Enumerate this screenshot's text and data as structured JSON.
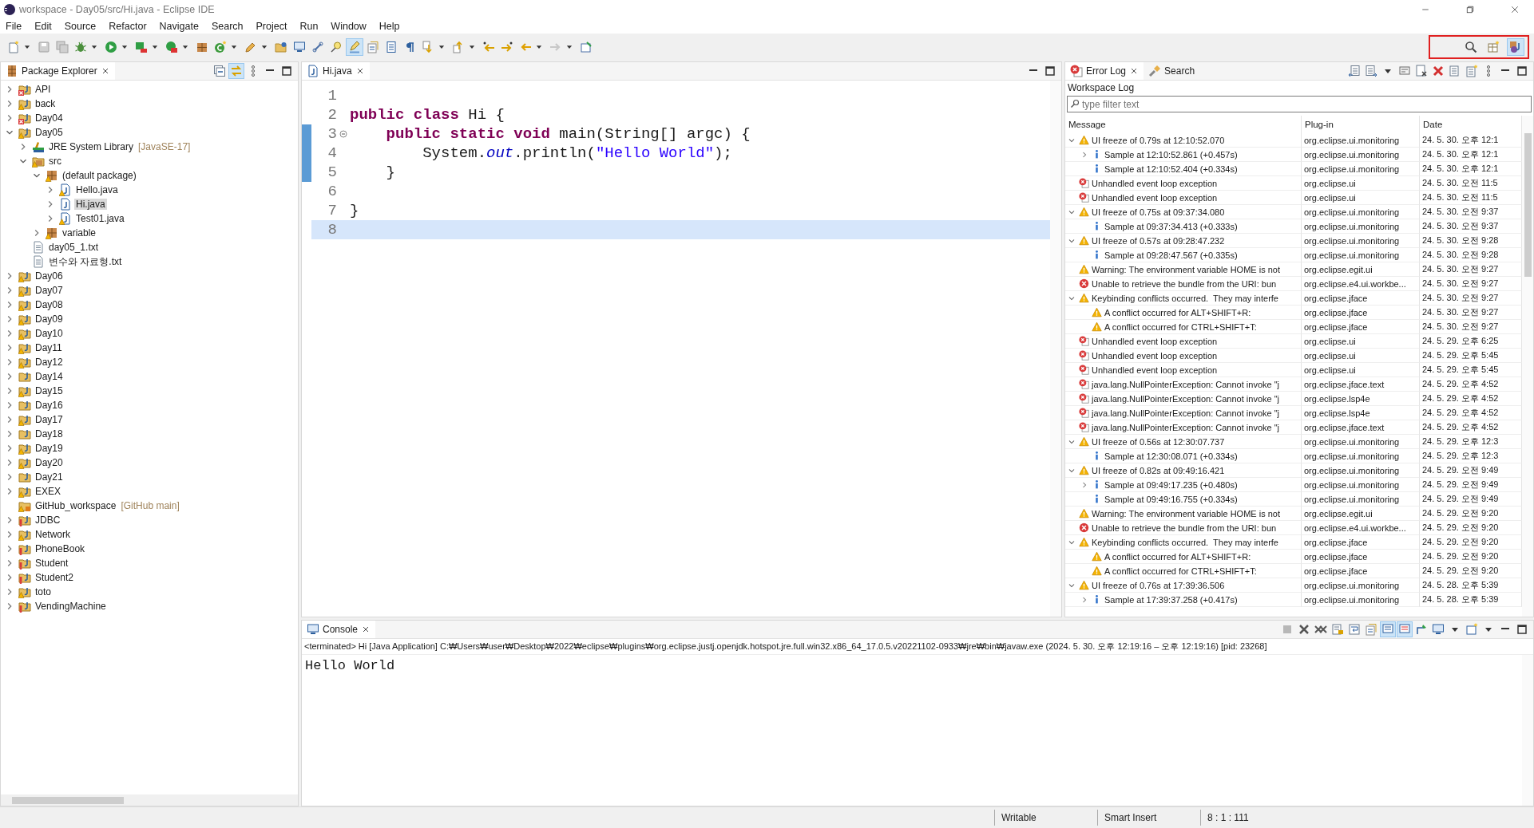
{
  "window": {
    "title": "workspace - Day05/src/Hi.java - Eclipse IDE"
  },
  "menu": [
    "File",
    "Edit",
    "Source",
    "Refactor",
    "Navigate",
    "Search",
    "Project",
    "Run",
    "Window",
    "Help"
  ],
  "toolbar": [
    {
      "kind": "new",
      "dropdown": true,
      "pressed": false
    },
    {
      "kind": "save",
      "dropdown": false,
      "pressed": false
    },
    {
      "kind": "saveall",
      "dropdown": false,
      "pressed": false
    },
    {
      "kind": "bug",
      "dropdown": true,
      "pressed": false
    },
    {
      "kind": "run",
      "dropdown": true,
      "pressed": false
    },
    {
      "kind": "coverage",
      "dropdown": true,
      "pressed": false
    },
    {
      "kind": "external",
      "dropdown": true,
      "pressed": false
    },
    {
      "kind": "package",
      "dropdown": false,
      "pressed": false
    },
    {
      "kind": "classnew",
      "dropdown": true,
      "pressed": false
    },
    {
      "kind": "pencil",
      "dropdown": true,
      "pressed": false
    },
    {
      "kind": "folder",
      "dropdown": false,
      "pressed": false
    },
    {
      "kind": "monitor",
      "dropdown": false,
      "pressed": false
    },
    {
      "kind": "link",
      "dropdown": false,
      "pressed": false
    },
    {
      "kind": "bulb",
      "dropdown": false,
      "pressed": false
    },
    {
      "kind": "highlight",
      "dropdown": false,
      "pressed": true
    },
    {
      "kind": "docref",
      "dropdown": false,
      "pressed": false
    },
    {
      "kind": "block",
      "dropdown": false,
      "pressed": false
    },
    {
      "kind": "pilcrow",
      "dropdown": false,
      "pressed": false
    },
    {
      "kind": "down",
      "dropdown": true,
      "pressed": false
    },
    {
      "kind": "up",
      "dropdown": true,
      "pressed": false
    },
    {
      "kind": "lastback",
      "dropdown": false,
      "pressed": false
    },
    {
      "kind": "lastfwd",
      "dropdown": false,
      "pressed": false
    },
    {
      "kind": "back",
      "dropdown": true,
      "pressed": false
    },
    {
      "kind": "forward",
      "dropdown": true,
      "pressed": false
    },
    {
      "kind": "pin",
      "dropdown": false,
      "pressed": false
    }
  ],
  "perspectives": [
    {
      "kind": "search",
      "pressed": false
    },
    {
      "kind": "perspective",
      "pressed": false
    },
    {
      "kind": "java",
      "pressed": true
    }
  ],
  "explorer": {
    "tab": "Package Explorer",
    "tools": [
      {
        "kind": "collapse",
        "pressed": false
      },
      {
        "kind": "sync",
        "pressed": true
      },
      {
        "kind": "dots",
        "pressed": false
      },
      {
        "kind": "min",
        "pressed": false
      },
      {
        "kind": "max",
        "pressed": false
      }
    ],
    "items": [
      {
        "label": "API",
        "kind": "project-error",
        "expanded": false,
        "selected": false
      },
      {
        "label": "back",
        "kind": "project-warning",
        "expanded": false,
        "selected": false
      },
      {
        "label": "Day04",
        "kind": "project-error",
        "expanded": false,
        "selected": false
      },
      {
        "label": "Day05",
        "kind": "project-warning",
        "expanded": true,
        "selected": false,
        "children": [
          {
            "label": "JRE System Library",
            "decoration": "[JavaSE-17]",
            "kind": "library",
            "expanded": false,
            "selected": false
          },
          {
            "label": "src",
            "kind": "srcfolder-warning",
            "expanded": true,
            "selected": false,
            "children": [
              {
                "label": "(default package)",
                "kind": "pkg-warning",
                "expanded": true,
                "selected": false,
                "children": [
                  {
                    "label": "Hello.java",
                    "kind": "java-warning",
                    "expanded": false,
                    "selected": false
                  },
                  {
                    "label": "Hi.java",
                    "kind": "java",
                    "expanded": false,
                    "selected": true
                  },
                  {
                    "label": "Test01.java",
                    "kind": "java-warning",
                    "expanded": false,
                    "selected": false
                  }
                ]
              },
              {
                "label": "variable",
                "kind": "pkg-warning",
                "expanded": false,
                "selected": false
              }
            ]
          },
          {
            "label": "day05_1.txt",
            "kind": "text",
            "selected": false
          },
          {
            "label": "변수와 자료형.txt",
            "kind": "text",
            "selected": false
          }
        ]
      },
      {
        "label": "Day06",
        "kind": "project-warning",
        "expanded": false,
        "selected": false
      },
      {
        "label": "Day07",
        "kind": "project-warning",
        "expanded": false,
        "selected": false
      },
      {
        "label": "Day08",
        "kind": "project-warning",
        "expanded": false,
        "selected": false
      },
      {
        "label": "Day09",
        "kind": "project-warning",
        "expanded": false,
        "selected": false
      },
      {
        "label": "Day10",
        "kind": "project-warning",
        "expanded": false,
        "selected": false
      },
      {
        "label": "Day11",
        "kind": "project-warning",
        "expanded": false,
        "selected": false
      },
      {
        "label": "Day12",
        "kind": "project-warning",
        "expanded": false,
        "selected": false
      },
      {
        "label": "Day14",
        "kind": "project",
        "expanded": false,
        "selected": false
      },
      {
        "label": "Day15",
        "kind": "project-warning",
        "expanded": false,
        "selected": false
      },
      {
        "label": "Day16",
        "kind": "project",
        "expanded": false,
        "selected": false
      },
      {
        "label": "Day17",
        "kind": "project-warning",
        "expanded": false,
        "selected": false
      },
      {
        "label": "Day18",
        "kind": "project",
        "expanded": false,
        "selected": false
      },
      {
        "label": "Day19",
        "kind": "project-warning",
        "expanded": false,
        "selected": false
      },
      {
        "label": "Day20",
        "kind": "project-warning",
        "expanded": false,
        "selected": false
      },
      {
        "label": "Day21",
        "kind": "project",
        "expanded": false,
        "selected": false
      },
      {
        "label": "EXEX",
        "kind": "project-warning",
        "expanded": false,
        "selected": false
      },
      {
        "label": "GitHub_workspace",
        "decoration": "[GitHub main]",
        "kind": "repo-warning",
        "selected": false
      },
      {
        "label": "JDBC",
        "kind": "project-problem",
        "expanded": false,
        "selected": false
      },
      {
        "label": "Network",
        "kind": "project-warning",
        "expanded": false,
        "selected": false
      },
      {
        "label": "PhoneBook",
        "kind": "project-problem",
        "expanded": false,
        "selected": false
      },
      {
        "label": "Student",
        "kind": "project-problem",
        "expanded": false,
        "selected": false
      },
      {
        "label": "Student2",
        "kind": "project-problem",
        "expanded": false,
        "selected": false
      },
      {
        "label": "toto",
        "kind": "project-warning",
        "expanded": false,
        "selected": false
      },
      {
        "label": "VendingMachine",
        "kind": "project-problem",
        "expanded": false,
        "selected": false
      }
    ]
  },
  "editor": {
    "tab": "Hi.java",
    "lines": [
      {
        "number": "1",
        "current": false,
        "in_range": false,
        "foldable": false
      },
      {
        "number": "2",
        "tokens": [
          {
            "kind": "keyword",
            "text": "public "
          },
          {
            "kind": "keyword",
            "text": "class "
          },
          {
            "kind": "plain",
            "text": "Hi {"
          }
        ],
        "current": false,
        "in_range": false,
        "foldable": false
      },
      {
        "number": "3",
        "tokens": [
          {
            "kind": "keyword",
            "text": "    public "
          },
          {
            "kind": "keyword",
            "text": "static "
          },
          {
            "kind": "keyword",
            "text": "void "
          },
          {
            "kind": "plain",
            "text": "main(String[] argc) {"
          }
        ],
        "current": false,
        "in_range": true,
        "foldable": true
      },
      {
        "number": "4",
        "tokens": [
          {
            "kind": "plain",
            "text": "        System."
          },
          {
            "kind": "field",
            "text": "out"
          },
          {
            "kind": "plain",
            "text": ".println("
          },
          {
            "kind": "string",
            "text": "\"Hello World\""
          },
          {
            "kind": "plain",
            "text": ");"
          }
        ],
        "current": false,
        "in_range": true,
        "foldable": false
      },
      {
        "number": "5",
        "tokens": [
          {
            "kind": "plain",
            "text": "    }"
          }
        ],
        "current": false,
        "in_range": true,
        "foldable": false
      },
      {
        "number": "6",
        "current": false,
        "in_range": false,
        "foldable": false
      },
      {
        "number": "7",
        "tokens": [
          {
            "kind": "plain",
            "text": "}"
          }
        ],
        "current": false,
        "in_range": false,
        "foldable": false
      },
      {
        "number": "8",
        "current": true,
        "in_range": false,
        "foldable": false
      }
    ]
  },
  "log": {
    "tabs": [
      {
        "label": "Error Log",
        "kind": "errordoc",
        "selected": true
      },
      {
        "label": "Search",
        "kind": "torch",
        "selected": false
      }
    ],
    "tools": [
      {
        "kind": "export",
        "pressed": false
      },
      {
        "kind": "import",
        "pressed": false
      },
      {
        "kind": "caret",
        "pressed": false
      },
      {
        "kind": "open",
        "pressed": false
      },
      {
        "kind": "clear",
        "pressed": false
      },
      {
        "kind": "delete",
        "pressed": false
      },
      {
        "kind": "restore",
        "pressed": false
      },
      {
        "kind": "importlog",
        "pressed": false
      },
      {
        "kind": "dots",
        "pressed": false
      },
      {
        "kind": "min",
        "pressed": false
      },
      {
        "kind": "max",
        "pressed": false
      }
    ],
    "subtitle": "Workspace Log",
    "filter": {
      "placeholder": "type filter text"
    },
    "columns": [
      "Message",
      "Plug-in",
      "Date"
    ],
    "rows": [
      {
        "kind": "warning",
        "message": "UI freeze of 0.79s at 12:10:52.070",
        "plugin": "org.eclipse.ui.monitoring",
        "date": "24. 5. 30. 오후 12:1",
        "expanded": true,
        "children": [
          {
            "kind": "info",
            "message": "Sample at 12:10:52.861 (+0.457s)",
            "plugin": "org.eclipse.ui.monitoring",
            "date": "24. 5. 30. 오후 12:1",
            "expanded": false
          },
          {
            "kind": "info",
            "message": "Sample at 12:10:52.404 (+0.334s)",
            "plugin": "org.eclipse.ui.monitoring",
            "date": "24. 5. 30. 오후 12:1"
          }
        ]
      },
      {
        "kind": "errordoc",
        "message": "Unhandled event loop exception",
        "plugin": "org.eclipse.ui",
        "date": "24. 5. 30. 오전 11:5"
      },
      {
        "kind": "errordoc",
        "message": "Unhandled event loop exception",
        "plugin": "org.eclipse.ui",
        "date": "24. 5. 30. 오전 11:5"
      },
      {
        "kind": "warning",
        "message": "UI freeze of 0.75s at 09:37:34.080",
        "plugin": "org.eclipse.ui.monitoring",
        "date": "24. 5. 30. 오전 9:37",
        "expanded": true,
        "children": [
          {
            "kind": "info",
            "message": "Sample at 09:37:34.413 (+0.333s)",
            "plugin": "org.eclipse.ui.monitoring",
            "date": "24. 5. 30. 오전 9:37"
          }
        ]
      },
      {
        "kind": "warning",
        "message": "UI freeze of 0.57s at 09:28:47.232",
        "plugin": "org.eclipse.ui.monitoring",
        "date": "24. 5. 30. 오전 9:28",
        "expanded": true,
        "children": [
          {
            "kind": "info",
            "message": "Sample at 09:28:47.567 (+0.335s)",
            "plugin": "org.eclipse.ui.monitoring",
            "date": "24. 5. 30. 오전 9:28"
          }
        ]
      },
      {
        "kind": "warning",
        "message": "Warning: The environment variable HOME is not",
        "plugin": "org.eclipse.egit.ui",
        "date": "24. 5. 30. 오전 9:27"
      },
      {
        "kind": "error",
        "message": "Unable to retrieve the bundle from the URI: bun",
        "plugin": "org.eclipse.e4.ui.workbe...",
        "date": "24. 5. 30. 오전 9:27"
      },
      {
        "kind": "warning",
        "message": "Keybinding conflicts occurred.  They may interfe",
        "plugin": "org.eclipse.jface",
        "date": "24. 5. 30. 오전 9:27",
        "expanded": true,
        "children": [
          {
            "kind": "warning",
            "message": "A conflict occurred for ALT+SHIFT+R:",
            "plugin": "org.eclipse.jface",
            "date": "24. 5. 30. 오전 9:27"
          },
          {
            "kind": "warning",
            "message": "A conflict occurred for CTRL+SHIFT+T:",
            "plugin": "org.eclipse.jface",
            "date": "24. 5. 30. 오전 9:27"
          }
        ]
      },
      {
        "kind": "errordoc",
        "message": "Unhandled event loop exception",
        "plugin": "org.eclipse.ui",
        "date": "24. 5. 29. 오후 6:25"
      },
      {
        "kind": "errordoc",
        "message": "Unhandled event loop exception",
        "plugin": "org.eclipse.ui",
        "date": "24. 5. 29. 오후 5:45"
      },
      {
        "kind": "errordoc",
        "message": "Unhandled event loop exception",
        "plugin": "org.eclipse.ui",
        "date": "24. 5. 29. 오후 5:45"
      },
      {
        "kind": "errordoc",
        "message": "java.lang.NullPointerException: Cannot invoke \"j",
        "plugin": "org.eclipse.jface.text",
        "date": "24. 5. 29. 오후 4:52"
      },
      {
        "kind": "errordoc",
        "message": "java.lang.NullPointerException: Cannot invoke \"j",
        "plugin": "org.eclipse.lsp4e",
        "date": "24. 5. 29. 오후 4:52"
      },
      {
        "kind": "errordoc",
        "message": "java.lang.NullPointerException: Cannot invoke \"j",
        "plugin": "org.eclipse.lsp4e",
        "date": "24. 5. 29. 오후 4:52"
      },
      {
        "kind": "errordoc",
        "message": "java.lang.NullPointerException: Cannot invoke \"j",
        "plugin": "org.eclipse.jface.text",
        "date": "24. 5. 29. 오후 4:52"
      },
      {
        "kind": "warning",
        "message": "UI freeze of 0.56s at 12:30:07.737",
        "plugin": "org.eclipse.ui.monitoring",
        "date": "24. 5. 29. 오후 12:3",
        "expanded": true,
        "children": [
          {
            "kind": "info",
            "message": "Sample at 12:30:08.071 (+0.334s)",
            "plugin": "org.eclipse.ui.monitoring",
            "date": "24. 5. 29. 오후 12:3"
          }
        ]
      },
      {
        "kind": "warning",
        "message": "UI freeze of 0.82s at 09:49:16.421",
        "plugin": "org.eclipse.ui.monitoring",
        "date": "24. 5. 29. 오전 9:49",
        "expanded": true,
        "children": [
          {
            "kind": "info",
            "message": "Sample at 09:49:17.235 (+0.480s)",
            "plugin": "org.eclipse.ui.monitoring",
            "date": "24. 5. 29. 오전 9:49",
            "expanded": false
          },
          {
            "kind": "info",
            "message": "Sample at 09:49:16.755 (+0.334s)",
            "plugin": "org.eclipse.ui.monitoring",
            "date": "24. 5. 29. 오전 9:49"
          }
        ]
      },
      {
        "kind": "warning",
        "message": "Warning: The environment variable HOME is not",
        "plugin": "org.eclipse.egit.ui",
        "date": "24. 5. 29. 오전 9:20"
      },
      {
        "kind": "error",
        "message": "Unable to retrieve the bundle from the URI: bun",
        "plugin": "org.eclipse.e4.ui.workbe...",
        "date": "24. 5. 29. 오전 9:20"
      },
      {
        "kind": "warning",
        "message": "Keybinding conflicts occurred.  They may interfe",
        "plugin": "org.eclipse.jface",
        "date": "24. 5. 29. 오전 9:20",
        "expanded": true,
        "children": [
          {
            "kind": "warning",
            "message": "A conflict occurred for ALT+SHIFT+R:",
            "plugin": "org.eclipse.jface",
            "date": "24. 5. 29. 오전 9:20"
          },
          {
            "kind": "warning",
            "message": "A conflict occurred for CTRL+SHIFT+T:",
            "plugin": "org.eclipse.jface",
            "date": "24. 5. 29. 오전 9:20"
          }
        ]
      },
      {
        "kind": "warning",
        "message": "UI freeze of 0.76s at 17:39:36.506",
        "plugin": "org.eclipse.ui.monitoring",
        "date": "24. 5. 28. 오후 5:39",
        "expanded": true,
        "children": [
          {
            "kind": "info",
            "message": "Sample at 17:39:37.258 (+0.417s)",
            "plugin": "org.eclipse.ui.monitoring",
            "date": "24. 5. 28. 오후 5:39",
            "expanded": false
          }
        ]
      }
    ]
  },
  "console": {
    "tab": "Console",
    "tools": [
      {
        "kind": "stop",
        "pressed": false
      },
      {
        "kind": "remove",
        "pressed": false
      },
      {
        "kind": "removeall",
        "pressed": false
      },
      {
        "kind": "scrolllock",
        "pressed": false
      },
      {
        "kind": "wrap",
        "pressed": false
      },
      {
        "kind": "docref",
        "pressed": false
      },
      {
        "kind": "stdout",
        "pressed": true
      },
      {
        "kind": "stderr",
        "pressed": true
      },
      {
        "kind": "consolepin",
        "pressed": false
      },
      {
        "kind": "display",
        "pressed": false
      },
      {
        "kind": "caret",
        "pressed": false
      },
      {
        "kind": "newconsole",
        "pressed": false
      },
      {
        "kind": "caret",
        "pressed": false
      },
      {
        "kind": "min",
        "pressed": false
      },
      {
        "kind": "max",
        "pressed": false
      }
    ],
    "status": "<terminated> Hi [Java Application] C:₩Users₩user₩Desktop₩2022₩eclipse₩plugins₩org.eclipse.justj.openjdk.hotspot.jre.full.win32.x86_64_17.0.5.v20221102-0933₩jre₩bin₩javaw.exe  (2024. 5. 30. 오후 12:19:16 – 오후 12:19:16) [pid: 23268]",
    "output": "Hello World"
  },
  "status_bar": [
    "Writable",
    "Smart Insert",
    "8 : 1 : 111"
  ]
}
